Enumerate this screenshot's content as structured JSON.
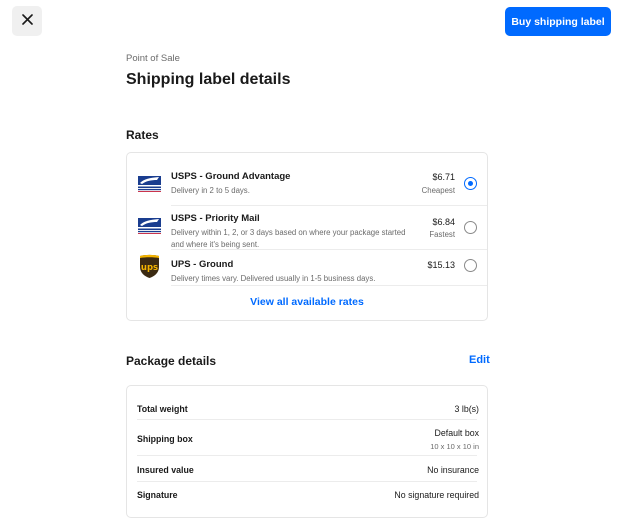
{
  "header": {
    "close_icon": "close-icon",
    "buy_label": "Buy shipping label",
    "accent_color": "#006aff"
  },
  "page": {
    "breadcrumb": "Point of Sale",
    "title": "Shipping label details"
  },
  "rates": {
    "title": "Rates",
    "items": [
      {
        "carrier_icon": "usps-logo-icon",
        "name": "USPS - Ground Advantage",
        "description": "Delivery in 2 to 5 days.",
        "price": "$6.71",
        "tag": "Cheapest",
        "selected": true
      },
      {
        "carrier_icon": "usps-logo-icon",
        "name": "USPS - Priority Mail",
        "description": "Delivery within 1, 2, or 3 days based on where your package started and where it's being sent.",
        "price": "$6.84",
        "tag": "Fastest",
        "selected": false
      },
      {
        "carrier_icon": "ups-logo-icon",
        "name": "UPS - Ground",
        "description": "Delivery times vary. Delivered usually in 1-5 business days.",
        "price": "$15.13",
        "tag": "",
        "selected": false
      }
    ],
    "view_all_label": "View all available rates"
  },
  "package": {
    "title": "Package details",
    "edit_label": "Edit",
    "rows": [
      {
        "label": "Total weight",
        "value": "3 lb(s)",
        "sub": ""
      },
      {
        "label": "Shipping box",
        "value": "Default box",
        "sub": "10 x 10 x 10 in"
      },
      {
        "label": "Insured value",
        "value": "No insurance",
        "sub": ""
      },
      {
        "label": "Signature",
        "value": "No signature required",
        "sub": ""
      }
    ]
  }
}
